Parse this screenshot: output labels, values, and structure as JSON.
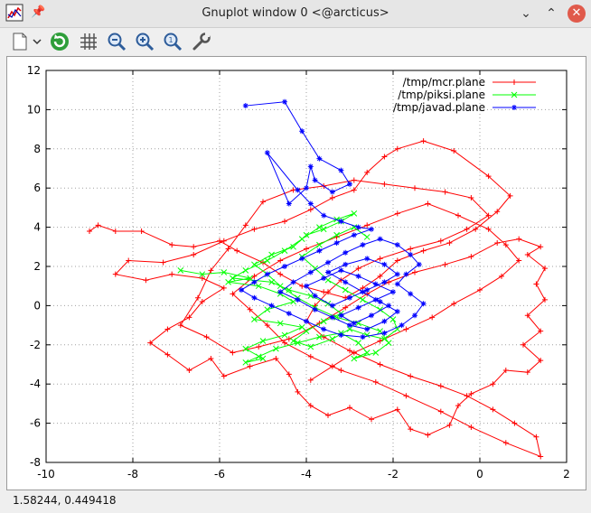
{
  "window": {
    "title": "Gnuplot window 0 <@arcticus>",
    "pin_icon": "pin-icon",
    "controls": [
      "minimize-icon",
      "maximize-icon",
      "close-icon"
    ]
  },
  "toolbar": {
    "buttons": [
      "export-icon",
      "dropdown-chevron-icon",
      "replot-icon",
      "grid-icon",
      "zoom-out-icon",
      "zoom-in-icon",
      "zoom-fit-icon",
      "settings-wrench-icon"
    ]
  },
  "statusbar": {
    "coords": "1.58244,  0.449418"
  },
  "chart_data": {
    "type": "line",
    "xlim": [
      -10,
      2
    ],
    "ylim": [
      -8,
      12
    ],
    "xticks": [
      "-10",
      "-8",
      "-6",
      "-4",
      "-2",
      "0",
      "2"
    ],
    "yticks": [
      "-8",
      "-6",
      "-4",
      "-2",
      "0",
      "2",
      "4",
      "6",
      "8",
      "10",
      "12"
    ],
    "grid": true,
    "legend_position": "top-right",
    "series": [
      {
        "name": "/tmp/mcr.plane",
        "color": "#ff0000",
        "marker": "+",
        "points": [
          [
            -9.0,
            3.8
          ],
          [
            -8.8,
            4.1
          ],
          [
            -8.4,
            3.8
          ],
          [
            -7.8,
            3.8
          ],
          [
            -7.1,
            3.1
          ],
          [
            -6.6,
            3.0
          ],
          [
            -6.0,
            3.3
          ],
          [
            -5.6,
            2.8
          ],
          [
            -5.0,
            2.2
          ],
          [
            -4.6,
            1.6
          ],
          [
            -4.1,
            1.0
          ],
          [
            -3.6,
            0.7
          ],
          [
            -3.1,
            0.4
          ],
          [
            -2.7,
            0.9
          ],
          [
            -2.3,
            1.5
          ],
          [
            -1.9,
            2.3
          ],
          [
            -1.3,
            2.8
          ],
          [
            -0.7,
            3.2
          ],
          [
            -0.1,
            3.9
          ],
          [
            0.4,
            4.8
          ],
          [
            0.7,
            5.6
          ],
          [
            0.2,
            6.6
          ],
          [
            -0.6,
            7.9
          ],
          [
            -1.3,
            8.4
          ],
          [
            -1.9,
            8.0
          ],
          [
            -2.2,
            7.6
          ],
          [
            -2.6,
            6.8
          ],
          [
            -2.9,
            5.9
          ],
          [
            -3.4,
            5.5
          ],
          [
            -3.9,
            4.9
          ],
          [
            -4.5,
            4.3
          ],
          [
            -5.2,
            3.9
          ],
          [
            -5.9,
            3.3
          ],
          [
            -6.6,
            2.6
          ],
          [
            -7.3,
            2.2
          ],
          [
            -8.1,
            2.3
          ],
          [
            -8.4,
            1.6
          ],
          [
            -7.7,
            1.3
          ],
          [
            -7.1,
            1.6
          ],
          [
            -6.4,
            1.4
          ],
          [
            -5.9,
            0.9
          ],
          [
            -6.4,
            0.2
          ],
          [
            -6.7,
            -0.6
          ],
          [
            -7.2,
            -1.2
          ],
          [
            -7.6,
            -1.9
          ],
          [
            -7.2,
            -2.5
          ],
          [
            -6.7,
            -3.3
          ],
          [
            -6.2,
            -2.7
          ],
          [
            -5.9,
            -3.6
          ],
          [
            -5.3,
            -3.1
          ],
          [
            -4.7,
            -2.7
          ],
          [
            -4.4,
            -3.5
          ],
          [
            -4.2,
            -4.4
          ],
          [
            -3.9,
            -5.1
          ],
          [
            -3.5,
            -5.6
          ],
          [
            -3.0,
            -5.2
          ],
          [
            -2.5,
            -5.8
          ],
          [
            -1.9,
            -5.3
          ],
          [
            -1.6,
            -6.3
          ],
          [
            -1.2,
            -6.6
          ],
          [
            -0.7,
            -6.1
          ],
          [
            -0.5,
            -5.1
          ],
          [
            -0.2,
            -4.5
          ],
          [
            0.3,
            -4.0
          ],
          [
            0.6,
            -3.3
          ],
          [
            1.1,
            -3.4
          ],
          [
            1.4,
            -2.8
          ],
          [
            1.0,
            -2.0
          ],
          [
            1.4,
            -1.3
          ],
          [
            1.1,
            -0.5
          ],
          [
            1.5,
            0.3
          ],
          [
            1.3,
            1.1
          ],
          [
            1.5,
            1.9
          ],
          [
            1.1,
            2.6
          ],
          [
            1.4,
            3.0
          ],
          [
            0.9,
            3.4
          ],
          [
            0.4,
            3.2
          ],
          [
            -0.2,
            2.5
          ],
          [
            -0.8,
            2.1
          ],
          [
            -1.5,
            1.7
          ],
          [
            -2.1,
            1.2
          ],
          [
            -2.6,
            0.6
          ],
          [
            -3.1,
            -0.1
          ],
          [
            -3.7,
            -0.9
          ],
          [
            -4.4,
            -1.7
          ],
          [
            -5.1,
            -2.1
          ],
          [
            -5.7,
            -2.4
          ],
          [
            -6.3,
            -1.6
          ],
          [
            -6.9,
            -1.0
          ],
          [
            -6.5,
            0.4
          ],
          [
            -6.2,
            1.8
          ],
          [
            -5.8,
            2.9
          ],
          [
            -5.4,
            4.1
          ],
          [
            -5.0,
            5.3
          ],
          [
            -4.3,
            5.9
          ],
          [
            -3.6,
            6.1
          ],
          [
            -2.9,
            6.4
          ],
          [
            -2.2,
            6.2
          ],
          [
            -1.5,
            6.0
          ],
          [
            -0.8,
            5.8
          ],
          [
            -0.2,
            5.5
          ],
          [
            0.2,
            4.6
          ],
          [
            -0.3,
            3.9
          ],
          [
            -0.9,
            3.3
          ],
          [
            -1.6,
            2.9
          ],
          [
            -2.3,
            2.4
          ],
          [
            -2.8,
            1.9
          ],
          [
            -3.2,
            1.3
          ],
          [
            -3.5,
            0.7
          ],
          [
            -3.8,
            0.0
          ],
          [
            -4.0,
            -0.8
          ],
          [
            -3.6,
            -1.6
          ],
          [
            -3.0,
            -2.3
          ],
          [
            -2.3,
            -3.0
          ],
          [
            -1.6,
            -3.6
          ],
          [
            -0.9,
            -4.1
          ],
          [
            -0.3,
            -4.6
          ],
          [
            0.3,
            -5.3
          ],
          [
            0.8,
            -6.0
          ],
          [
            1.3,
            -6.7
          ],
          [
            1.4,
            -7.7
          ],
          [
            0.6,
            -7.0
          ],
          [
            -0.2,
            -6.2
          ],
          [
            -0.9,
            -5.4
          ],
          [
            -1.7,
            -4.6
          ],
          [
            -2.4,
            -3.9
          ],
          [
            -3.2,
            -3.3
          ],
          [
            -3.9,
            -2.6
          ],
          [
            -4.5,
            -1.9
          ],
          [
            -4.9,
            -1.0
          ],
          [
            -5.3,
            -0.2
          ],
          [
            -5.7,
            0.6
          ],
          [
            -5.2,
            1.5
          ],
          [
            -4.6,
            2.3
          ],
          [
            -4.0,
            2.9
          ],
          [
            -3.3,
            3.5
          ],
          [
            -2.6,
            4.1
          ],
          [
            -1.9,
            4.7
          ],
          [
            -1.2,
            5.2
          ],
          [
            -0.5,
            4.6
          ],
          [
            0.2,
            3.9
          ],
          [
            0.6,
            3.1
          ],
          [
            0.9,
            2.3
          ],
          [
            0.5,
            1.5
          ],
          [
            0.0,
            0.8
          ],
          [
            -0.6,
            0.1
          ],
          [
            -1.1,
            -0.6
          ],
          [
            -1.7,
            -1.2
          ],
          [
            -2.3,
            -1.8
          ],
          [
            -2.9,
            -2.4
          ],
          [
            -3.4,
            -3.1
          ],
          [
            -3.9,
            -3.8
          ]
        ]
      },
      {
        "name": "/tmp/piksi.plane",
        "color": "#00ff00",
        "marker": "x",
        "points": [
          [
            -6.9,
            1.8
          ],
          [
            -6.4,
            1.6
          ],
          [
            -5.9,
            1.7
          ],
          [
            -5.3,
            1.4
          ],
          [
            -5.8,
            1.2
          ],
          [
            -5.1,
            1.0
          ],
          [
            -4.6,
            0.6
          ],
          [
            -4.3,
            0.2
          ],
          [
            -4.9,
            -0.2
          ],
          [
            -5.2,
            -0.7
          ],
          [
            -4.6,
            -0.9
          ],
          [
            -4.1,
            -1.1
          ],
          [
            -4.5,
            -1.5
          ],
          [
            -5.0,
            -1.8
          ],
          [
            -5.4,
            -2.2
          ],
          [
            -5.0,
            -2.7
          ],
          [
            -5.4,
            -2.9
          ],
          [
            -5.1,
            -2.6
          ],
          [
            -4.7,
            -2.2
          ],
          [
            -4.2,
            -1.9
          ],
          [
            -3.7,
            -1.6
          ],
          [
            -3.2,
            -1.4
          ],
          [
            -2.8,
            -1.9
          ],
          [
            -2.6,
            -2.4
          ],
          [
            -2.9,
            -2.7
          ],
          [
            -2.4,
            -2.4
          ],
          [
            -2.1,
            -1.9
          ],
          [
            -2.3,
            -1.3
          ],
          [
            -2.8,
            -0.9
          ],
          [
            -3.3,
            -0.6
          ],
          [
            -3.8,
            -0.1
          ],
          [
            -4.2,
            0.4
          ],
          [
            -4.6,
            1.0
          ],
          [
            -4.9,
            1.6
          ],
          [
            -5.2,
            2.1
          ],
          [
            -4.8,
            2.6
          ],
          [
            -4.3,
            3.0
          ],
          [
            -4.0,
            3.6
          ],
          [
            -3.6,
            3.9
          ],
          [
            -3.2,
            4.3
          ],
          [
            -2.9,
            4.7
          ],
          [
            -3.3,
            4.4
          ],
          [
            -3.7,
            4.0
          ],
          [
            -4.1,
            3.4
          ],
          [
            -4.5,
            2.8
          ],
          [
            -4.9,
            2.3
          ],
          [
            -5.4,
            1.8
          ],
          [
            -5.7,
            1.4
          ],
          [
            -4.8,
            1.2
          ],
          [
            -4.4,
            0.8
          ],
          [
            -3.9,
            0.5
          ],
          [
            -3.5,
            0.1
          ],
          [
            -3.2,
            -0.4
          ],
          [
            -3.6,
            -0.8
          ],
          [
            -4.0,
            -1.3
          ],
          [
            -4.3,
            -1.8
          ],
          [
            -3.9,
            -2.1
          ],
          [
            -3.4,
            -1.7
          ],
          [
            -3.0,
            -1.2
          ],
          [
            -2.6,
            -1.5
          ],
          [
            -2.2,
            -1.7
          ],
          [
            -1.9,
            -1.2
          ],
          [
            -2.0,
            -0.7
          ],
          [
            -2.3,
            -0.2
          ],
          [
            -2.7,
            0.3
          ],
          [
            -3.1,
            0.8
          ],
          [
            -3.5,
            1.3
          ],
          [
            -3.8,
            1.9
          ],
          [
            -4.1,
            2.5
          ],
          [
            -3.7,
            3.1
          ],
          [
            -3.3,
            3.6
          ],
          [
            -2.9,
            4.0
          ],
          [
            -2.6,
            3.5
          ]
        ]
      },
      {
        "name": "/tmp/javad.plane",
        "color": "#0000ff",
        "marker": "*",
        "points": [
          [
            -5.4,
            10.2
          ],
          [
            -4.5,
            10.4
          ],
          [
            -4.1,
            8.9
          ],
          [
            -3.7,
            7.5
          ],
          [
            -3.2,
            6.9
          ],
          [
            -3.0,
            6.2
          ],
          [
            -3.4,
            5.8
          ],
          [
            -3.8,
            6.4
          ],
          [
            -3.9,
            7.1
          ],
          [
            -4.0,
            6.0
          ],
          [
            -4.4,
            5.2
          ],
          [
            -4.9,
            7.8
          ],
          [
            -4.2,
            5.9
          ],
          [
            -3.9,
            5.2
          ],
          [
            -3.6,
            4.6
          ],
          [
            -3.2,
            4.3
          ],
          [
            -2.8,
            4.0
          ],
          [
            -2.5,
            3.9
          ],
          [
            -2.9,
            3.6
          ],
          [
            -3.3,
            3.2
          ],
          [
            -3.7,
            2.8
          ],
          [
            -4.1,
            2.4
          ],
          [
            -4.5,
            2.0
          ],
          [
            -4.9,
            1.6
          ],
          [
            -5.2,
            1.2
          ],
          [
            -5.5,
            0.8
          ],
          [
            -5.2,
            0.4
          ],
          [
            -4.8,
            0.0
          ],
          [
            -4.4,
            -0.4
          ],
          [
            -4.0,
            -0.8
          ],
          [
            -3.6,
            -1.2
          ],
          [
            -3.2,
            -1.5
          ],
          [
            -2.7,
            -1.6
          ],
          [
            -2.2,
            -1.4
          ],
          [
            -1.8,
            -1.0
          ],
          [
            -1.5,
            -0.5
          ],
          [
            -1.3,
            0.1
          ],
          [
            -1.6,
            0.6
          ],
          [
            -1.9,
            1.1
          ],
          [
            -1.7,
            1.6
          ],
          [
            -1.4,
            2.1
          ],
          [
            -1.6,
            2.6
          ],
          [
            -1.9,
            3.1
          ],
          [
            -2.3,
            3.4
          ],
          [
            -2.7,
            3.1
          ],
          [
            -3.1,
            2.7
          ],
          [
            -3.5,
            2.2
          ],
          [
            -3.9,
            1.7
          ],
          [
            -4.3,
            1.2
          ],
          [
            -4.6,
            0.7
          ],
          [
            -4.2,
            0.3
          ],
          [
            -3.8,
            -0.2
          ],
          [
            -3.4,
            -0.6
          ],
          [
            -3.0,
            -1.0
          ],
          [
            -2.6,
            -1.2
          ],
          [
            -2.2,
            -0.8
          ],
          [
            -1.9,
            -0.3
          ],
          [
            -2.3,
            0.2
          ],
          [
            -2.7,
            0.7
          ],
          [
            -3.1,
            1.2
          ],
          [
            -3.5,
            1.7
          ],
          [
            -3.1,
            2.1
          ],
          [
            -2.6,
            2.4
          ],
          [
            -2.2,
            2.1
          ],
          [
            -1.9,
            1.6
          ],
          [
            -2.2,
            1.2
          ],
          [
            -2.6,
            0.8
          ],
          [
            -3.0,
            0.4
          ],
          [
            -3.4,
            0.0
          ],
          [
            -3.8,
            0.5
          ],
          [
            -4.0,
            1.0
          ],
          [
            -3.6,
            1.4
          ],
          [
            -3.2,
            1.8
          ],
          [
            -2.8,
            1.5
          ],
          [
            -2.4,
            1.1
          ],
          [
            -2.0,
            0.7
          ],
          [
            -2.4,
            0.3
          ],
          [
            -2.8,
            -0.1
          ],
          [
            -3.2,
            -0.5
          ],
          [
            -2.9,
            -0.9
          ],
          [
            -2.5,
            -0.5
          ],
          [
            -2.1,
            0.0
          ]
        ]
      }
    ]
  }
}
